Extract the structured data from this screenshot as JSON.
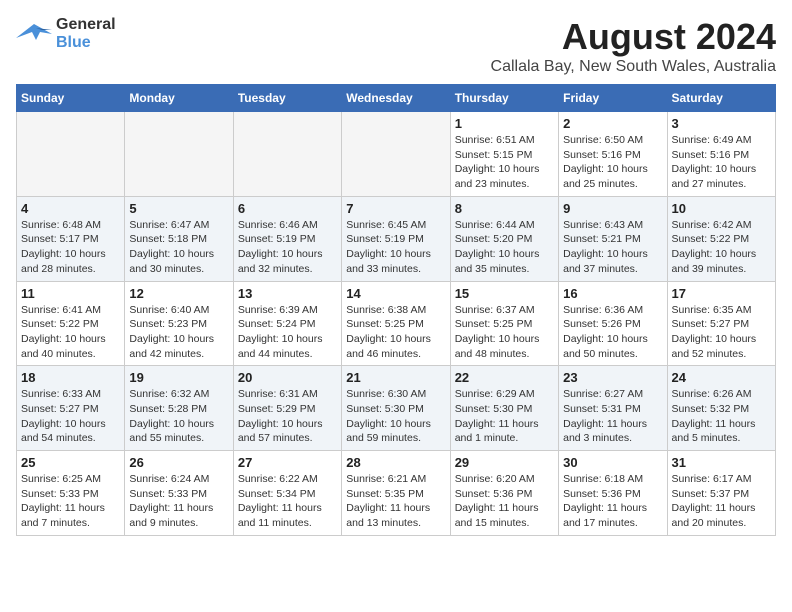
{
  "logo": {
    "line1": "General",
    "line2": "Blue"
  },
  "title": "August 2024",
  "subtitle": "Callala Bay, New South Wales, Australia",
  "weekdays": [
    "Sunday",
    "Monday",
    "Tuesday",
    "Wednesday",
    "Thursday",
    "Friday",
    "Saturday"
  ],
  "weeks": [
    [
      {
        "day": "",
        "info": ""
      },
      {
        "day": "",
        "info": ""
      },
      {
        "day": "",
        "info": ""
      },
      {
        "day": "",
        "info": ""
      },
      {
        "day": "1",
        "info": "Sunrise: 6:51 AM\nSunset: 5:15 PM\nDaylight: 10 hours\nand 23 minutes."
      },
      {
        "day": "2",
        "info": "Sunrise: 6:50 AM\nSunset: 5:16 PM\nDaylight: 10 hours\nand 25 minutes."
      },
      {
        "day": "3",
        "info": "Sunrise: 6:49 AM\nSunset: 5:16 PM\nDaylight: 10 hours\nand 27 minutes."
      }
    ],
    [
      {
        "day": "4",
        "info": "Sunrise: 6:48 AM\nSunset: 5:17 PM\nDaylight: 10 hours\nand 28 minutes."
      },
      {
        "day": "5",
        "info": "Sunrise: 6:47 AM\nSunset: 5:18 PM\nDaylight: 10 hours\nand 30 minutes."
      },
      {
        "day": "6",
        "info": "Sunrise: 6:46 AM\nSunset: 5:19 PM\nDaylight: 10 hours\nand 32 minutes."
      },
      {
        "day": "7",
        "info": "Sunrise: 6:45 AM\nSunset: 5:19 PM\nDaylight: 10 hours\nand 33 minutes."
      },
      {
        "day": "8",
        "info": "Sunrise: 6:44 AM\nSunset: 5:20 PM\nDaylight: 10 hours\nand 35 minutes."
      },
      {
        "day": "9",
        "info": "Sunrise: 6:43 AM\nSunset: 5:21 PM\nDaylight: 10 hours\nand 37 minutes."
      },
      {
        "day": "10",
        "info": "Sunrise: 6:42 AM\nSunset: 5:22 PM\nDaylight: 10 hours\nand 39 minutes."
      }
    ],
    [
      {
        "day": "11",
        "info": "Sunrise: 6:41 AM\nSunset: 5:22 PM\nDaylight: 10 hours\nand 40 minutes."
      },
      {
        "day": "12",
        "info": "Sunrise: 6:40 AM\nSunset: 5:23 PM\nDaylight: 10 hours\nand 42 minutes."
      },
      {
        "day": "13",
        "info": "Sunrise: 6:39 AM\nSunset: 5:24 PM\nDaylight: 10 hours\nand 44 minutes."
      },
      {
        "day": "14",
        "info": "Sunrise: 6:38 AM\nSunset: 5:25 PM\nDaylight: 10 hours\nand 46 minutes."
      },
      {
        "day": "15",
        "info": "Sunrise: 6:37 AM\nSunset: 5:25 PM\nDaylight: 10 hours\nand 48 minutes."
      },
      {
        "day": "16",
        "info": "Sunrise: 6:36 AM\nSunset: 5:26 PM\nDaylight: 10 hours\nand 50 minutes."
      },
      {
        "day": "17",
        "info": "Sunrise: 6:35 AM\nSunset: 5:27 PM\nDaylight: 10 hours\nand 52 minutes."
      }
    ],
    [
      {
        "day": "18",
        "info": "Sunrise: 6:33 AM\nSunset: 5:27 PM\nDaylight: 10 hours\nand 54 minutes."
      },
      {
        "day": "19",
        "info": "Sunrise: 6:32 AM\nSunset: 5:28 PM\nDaylight: 10 hours\nand 55 minutes."
      },
      {
        "day": "20",
        "info": "Sunrise: 6:31 AM\nSunset: 5:29 PM\nDaylight: 10 hours\nand 57 minutes."
      },
      {
        "day": "21",
        "info": "Sunrise: 6:30 AM\nSunset: 5:30 PM\nDaylight: 10 hours\nand 59 minutes."
      },
      {
        "day": "22",
        "info": "Sunrise: 6:29 AM\nSunset: 5:30 PM\nDaylight: 11 hours\nand 1 minute."
      },
      {
        "day": "23",
        "info": "Sunrise: 6:27 AM\nSunset: 5:31 PM\nDaylight: 11 hours\nand 3 minutes."
      },
      {
        "day": "24",
        "info": "Sunrise: 6:26 AM\nSunset: 5:32 PM\nDaylight: 11 hours\nand 5 minutes."
      }
    ],
    [
      {
        "day": "25",
        "info": "Sunrise: 6:25 AM\nSunset: 5:33 PM\nDaylight: 11 hours\nand 7 minutes."
      },
      {
        "day": "26",
        "info": "Sunrise: 6:24 AM\nSunset: 5:33 PM\nDaylight: 11 hours\nand 9 minutes."
      },
      {
        "day": "27",
        "info": "Sunrise: 6:22 AM\nSunset: 5:34 PM\nDaylight: 11 hours\nand 11 minutes."
      },
      {
        "day": "28",
        "info": "Sunrise: 6:21 AM\nSunset: 5:35 PM\nDaylight: 11 hours\nand 13 minutes."
      },
      {
        "day": "29",
        "info": "Sunrise: 6:20 AM\nSunset: 5:36 PM\nDaylight: 11 hours\nand 15 minutes."
      },
      {
        "day": "30",
        "info": "Sunrise: 6:18 AM\nSunset: 5:36 PM\nDaylight: 11 hours\nand 17 minutes."
      },
      {
        "day": "31",
        "info": "Sunrise: 6:17 AM\nSunset: 5:37 PM\nDaylight: 11 hours\nand 20 minutes."
      }
    ]
  ]
}
